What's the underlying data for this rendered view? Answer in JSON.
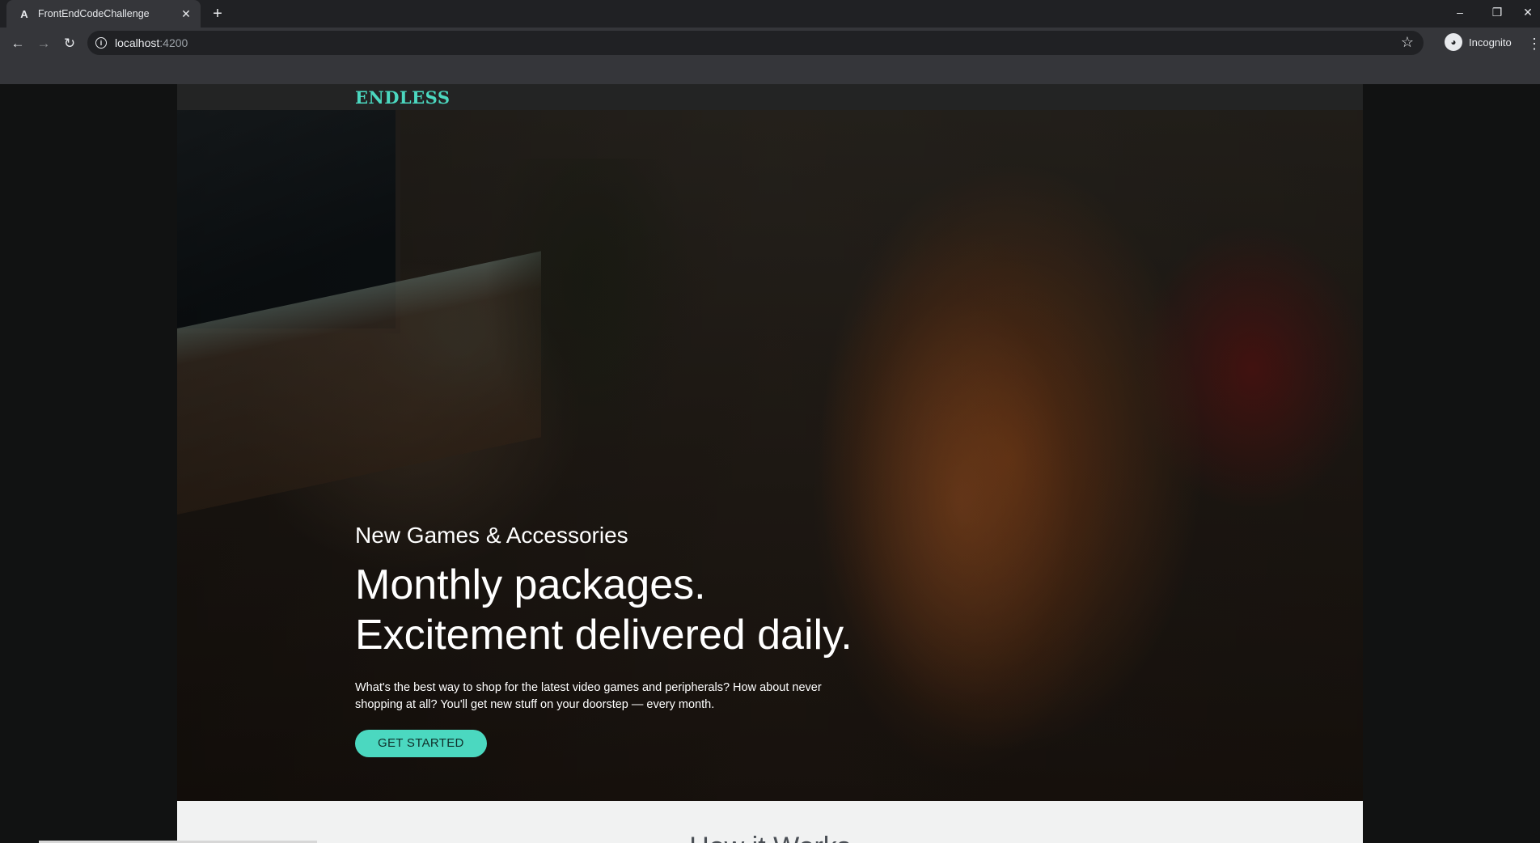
{
  "browser": {
    "tab_title": "FrontEndCodeChallenge",
    "tab_favicon": "A",
    "url_host": "localhost",
    "url_port": ":4200",
    "profile_label": "Incognito",
    "icons": [
      "back-arrow-icon",
      "forward-arrow-icon",
      "reload-icon",
      "info-icon",
      "star-icon",
      "incognito-icon",
      "menu-icon",
      "close-icon",
      "plus-icon",
      "minimize-icon",
      "restore-icon"
    ]
  },
  "site": {
    "logo": "ENDLESS",
    "accent_color": "#4bd8c0",
    "hero": {
      "eyebrow": "New Games & Accessories",
      "headline_line1": "Monthly packages.",
      "headline_line2": "Excitement delivered daily.",
      "blurb": "What's the best way to shop for the latest video games and peripherals? How about never shopping at all? You'll get new stuff on your doorstep — every month.",
      "cta_label": "GET STARTED"
    },
    "how_it_works": {
      "title": "How it Works"
    }
  }
}
